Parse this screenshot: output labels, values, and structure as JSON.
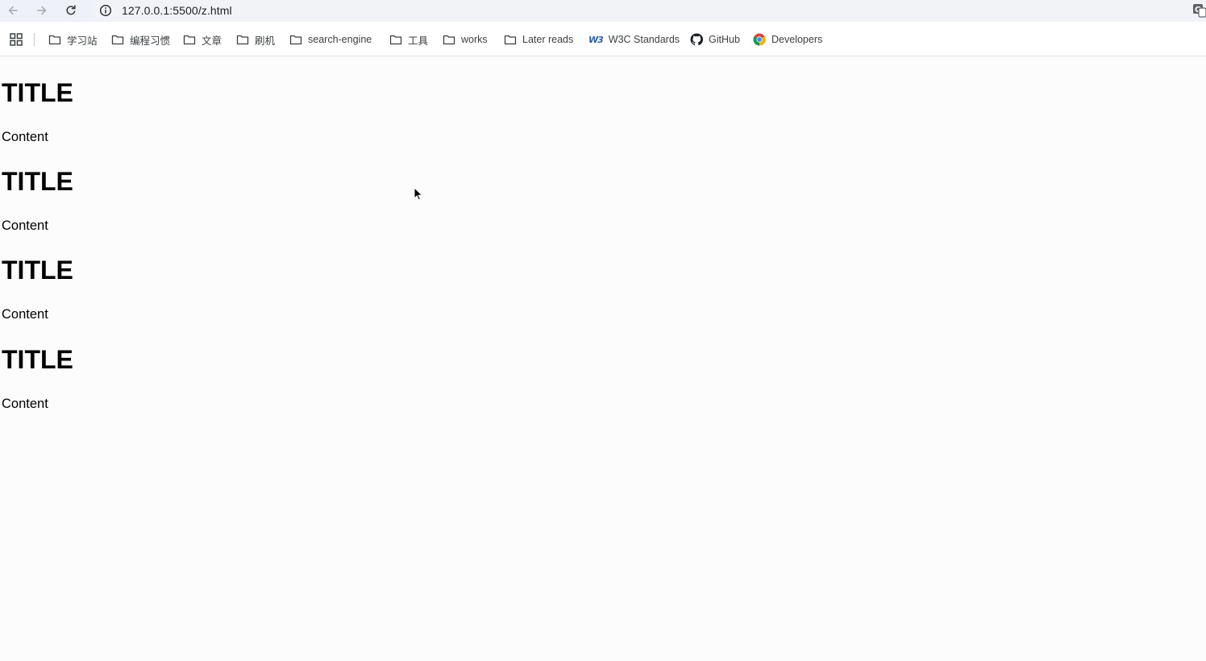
{
  "browser": {
    "url": "127.0.0.1:5500/z.html",
    "icons": {
      "back": "arrow-left-icon",
      "forward": "arrow-right-icon",
      "reload": "reload-icon",
      "site_info": "info-icon",
      "translate": "translate-icon"
    }
  },
  "bookmarks": {
    "items": [
      {
        "label": "学习站",
        "icon": "folder-icon"
      },
      {
        "label": "编程习惯",
        "icon": "folder-icon"
      },
      {
        "label": "文章",
        "icon": "folder-icon"
      },
      {
        "label": "刷机",
        "icon": "folder-icon"
      },
      {
        "label": "search-engine",
        "icon": "folder-icon"
      },
      {
        "label": "工具",
        "icon": "folder-icon"
      },
      {
        "label": "works",
        "icon": "folder-icon"
      },
      {
        "label": "Later reads",
        "icon": "folder-icon"
      },
      {
        "label": "W3C Standards",
        "icon": "w3c-icon"
      },
      {
        "label": "GitHub",
        "icon": "github-icon"
      },
      {
        "label": "Developers",
        "icon": "chrome-icon"
      }
    ]
  },
  "page": {
    "sections": [
      {
        "title": "TITLE",
        "content": "Content"
      },
      {
        "title": "TITLE",
        "content": "Content"
      },
      {
        "title": "TITLE",
        "content": "Content"
      },
      {
        "title": "TITLE",
        "content": "Content"
      }
    ]
  }
}
